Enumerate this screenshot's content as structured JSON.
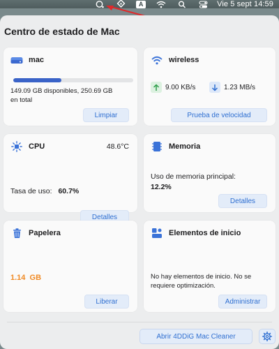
{
  "menubar": {
    "clock": "Vie 5 sept 14:59",
    "input_source": "A"
  },
  "panel": {
    "title": "Centro de estado de Mac"
  },
  "storage": {
    "title": "mac",
    "usage_fraction": 0.4,
    "detail_line1": "149.09 GB disponibles, 250.69 GB",
    "detail_line2": "en total",
    "button": "Limpiar"
  },
  "network": {
    "title": "wireless",
    "upload": "9.00 KB/s",
    "download": "1.23 MB/s",
    "button": "Prueba de velocidad"
  },
  "cpu": {
    "title": "CPU",
    "temperature": "48.6°C",
    "usage_label": "Tasa de uso:",
    "usage_value": "60.7%",
    "button": "Detalles"
  },
  "memory": {
    "title": "Memoria",
    "usage_label": "Uso de memoria principal:",
    "usage_value": "12.2%",
    "button": "Detalles"
  },
  "trash": {
    "title": "Papelera",
    "size": "1.14  GB",
    "button": "Liberar"
  },
  "startup": {
    "title": "Elementos de inicio",
    "message_line1": "No hay elementos de inicio. No se",
    "message_line2": "requiere optimización.",
    "button": "Administrar"
  },
  "footer": {
    "open_button": "Abrir 4DDiG Mac Cleaner"
  },
  "colors": {
    "accent": "#2f6fd1",
    "storage_bar": "#3a63c8",
    "trash_size": "#f08a24",
    "upload_green": "#2e9e4a",
    "download_blue": "#2f6fd1"
  },
  "icons": [
    "chat-icon",
    "app-status-icon",
    "input-source-icon",
    "wifi-icon",
    "search-icon",
    "control-center-icon",
    "drive-icon",
    "wifi-icon",
    "cpu-icon",
    "memory-icon",
    "trash-icon",
    "startup-icon",
    "gear-icon"
  ]
}
